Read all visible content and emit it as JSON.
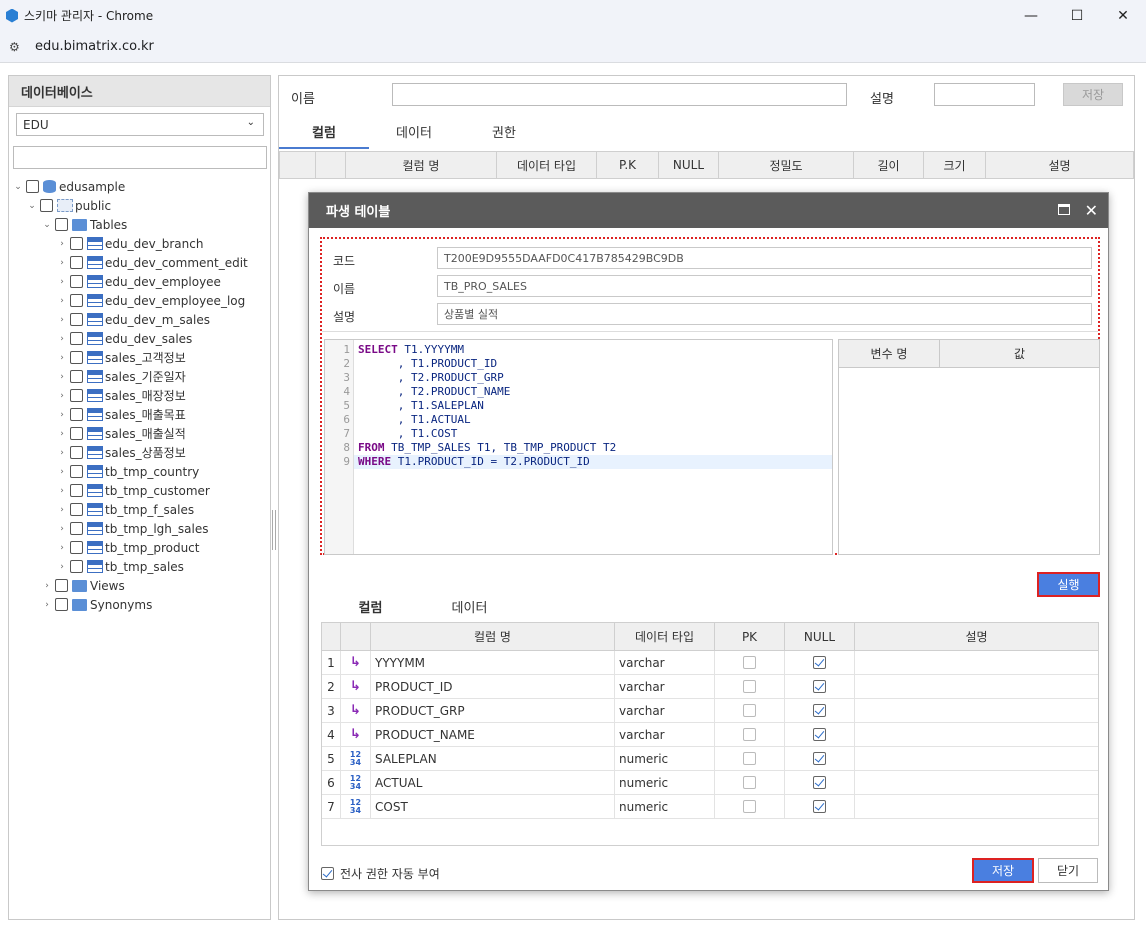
{
  "window": {
    "title": "스키마 관리자 - Chrome",
    "url": "edu.bimatrix.co.kr",
    "minimize": "—",
    "maximize": "☐",
    "close": "✕"
  },
  "left": {
    "header": "데이터베이스",
    "db_selected": "EDU",
    "tree": {
      "root": "edusample",
      "schema": "public",
      "tables_folder": "Tables",
      "tables": [
        "edu_dev_branch",
        "edu_dev_comment_edit",
        "edu_dev_employee",
        "edu_dev_employee_log",
        "edu_dev_m_sales",
        "edu_dev_sales",
        "sales_고객정보",
        "sales_기준일자",
        "sales_매장정보",
        "sales_매출목표",
        "sales_매출실적",
        "sales_상품정보",
        "tb_tmp_country",
        "tb_tmp_customer",
        "tb_tmp_f_sales",
        "tb_tmp_lgh_sales",
        "tb_tmp_product",
        "tb_tmp_sales"
      ],
      "views": "Views",
      "synonyms": "Synonyms"
    }
  },
  "main": {
    "name_label": "이름",
    "desc_label": "설명",
    "save_label": "저장",
    "tabs": [
      "컬럼",
      "데이터",
      "권한"
    ],
    "columns": [
      "컬럼 명",
      "데이터 타입",
      "P.K",
      "NULL",
      "정밀도",
      "길이",
      "크기",
      "설명"
    ]
  },
  "modal": {
    "title": "파생 테이블",
    "code_label": "코드",
    "code_value": "T200E9D9555DAAFD0C417B785429BC9DB",
    "name_label": "이름",
    "name_value": "TB_PRO_SALES",
    "desc_label": "설명",
    "desc_value": "상품별 실적",
    "sql_lines": [
      {
        "n": "1",
        "kw": "SELECT",
        "rest": " T1.YYYYMM"
      },
      {
        "n": "2",
        "kw": "",
        "rest": "      , T1.PRODUCT_ID"
      },
      {
        "n": "3",
        "kw": "",
        "rest": "      , T2.PRODUCT_GRP"
      },
      {
        "n": "4",
        "kw": "",
        "rest": "      , T2.PRODUCT_NAME"
      },
      {
        "n": "5",
        "kw": "",
        "rest": "      , T1.SALEPLAN"
      },
      {
        "n": "6",
        "kw": "",
        "rest": "      , T1.ACTUAL"
      },
      {
        "n": "7",
        "kw": "",
        "rest": "      , T1.COST"
      },
      {
        "n": "8",
        "kw": "FROM",
        "rest": " TB_TMP_SALES T1, TB_TMP_PRODUCT T2"
      },
      {
        "n": "9",
        "kw": "WHERE",
        "rest": " T1.PRODUCT_ID = T2.PRODUCT_ID"
      }
    ],
    "var_headers": [
      "변수 명",
      "값"
    ],
    "run_label": "실행",
    "tabs": [
      "컬럼",
      "데이터"
    ],
    "grid_headers": [
      "컬럼 명",
      "데이터 타입",
      "PK",
      "NULL",
      "설명"
    ],
    "rows": [
      {
        "n": "1",
        "type_icon": "string-icon",
        "name": "YYYYMM",
        "dtype": "varchar",
        "pk": false,
        "nullable": true
      },
      {
        "n": "2",
        "type_icon": "string-icon",
        "name": "PRODUCT_ID",
        "dtype": "varchar",
        "pk": false,
        "nullable": true
      },
      {
        "n": "3",
        "type_icon": "string-icon",
        "name": "PRODUCT_GRP",
        "dtype": "varchar",
        "pk": false,
        "nullable": true
      },
      {
        "n": "4",
        "type_icon": "string-icon",
        "name": "PRODUCT_NAME",
        "dtype": "varchar",
        "pk": false,
        "nullable": true
      },
      {
        "n": "5",
        "type_icon": "numeric-icon",
        "name": "SALEPLAN",
        "dtype": "numeric",
        "pk": false,
        "nullable": true
      },
      {
        "n": "6",
        "type_icon": "numeric-icon",
        "name": "ACTUAL",
        "dtype": "numeric",
        "pk": false,
        "nullable": true
      },
      {
        "n": "7",
        "type_icon": "numeric-icon",
        "name": "COST",
        "dtype": "numeric",
        "pk": false,
        "nullable": true
      }
    ],
    "auto_grant_label": "전사 권한 자동 부여",
    "auto_grant_checked": true,
    "save_label": "저장",
    "close_label": "닫기"
  }
}
